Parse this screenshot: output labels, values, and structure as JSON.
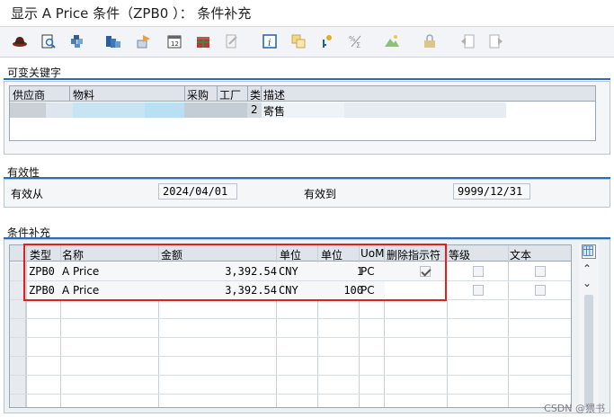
{
  "window": {
    "title": "显示 A Price 条件（ZPB0 ）：  条件补充"
  },
  "toolbar": {
    "icons": [
      "hat-icon",
      "document-search-icon",
      "puzzle-icon",
      "stack-icon",
      "transfer-icon",
      "calendar-icon",
      "gift-icon",
      "edit-icon",
      "info-icon",
      "copy-icon",
      "key-icon",
      "formula-icon",
      "mountain-icon",
      "lock-icon",
      "back-icon",
      "forward-icon"
    ]
  },
  "key_fields": {
    "section_title": "可变关键字",
    "columns": [
      "供应商",
      "物料",
      "采购",
      "工厂",
      "类",
      "描述"
    ],
    "row": {
      "type": "2",
      "description": "寄售"
    }
  },
  "validity": {
    "section_title": "有效性",
    "valid_from_label": "有效从",
    "valid_from": "2024/04/01",
    "valid_to_label": "有效到",
    "valid_to": "9999/12/31"
  },
  "supplements": {
    "section_title": "条件补充",
    "columns": [
      "类型",
      "名称",
      "金额",
      "单位",
      "单位",
      "UoM",
      "删除指示符",
      "等级",
      "文本"
    ],
    "rows": [
      {
        "type": "ZPB0",
        "name": "A Price",
        "amount": "3,392.54",
        "unit": "CNY",
        "per": "1",
        "uom": "PC",
        "deleted": true
      },
      {
        "type": "ZPB0",
        "name": "A Price",
        "amount": "3,392.54",
        "unit": "CNY",
        "per": "100",
        "uom": "PC",
        "deleted": false
      }
    ]
  },
  "watermark": "CSDN @猥书"
}
